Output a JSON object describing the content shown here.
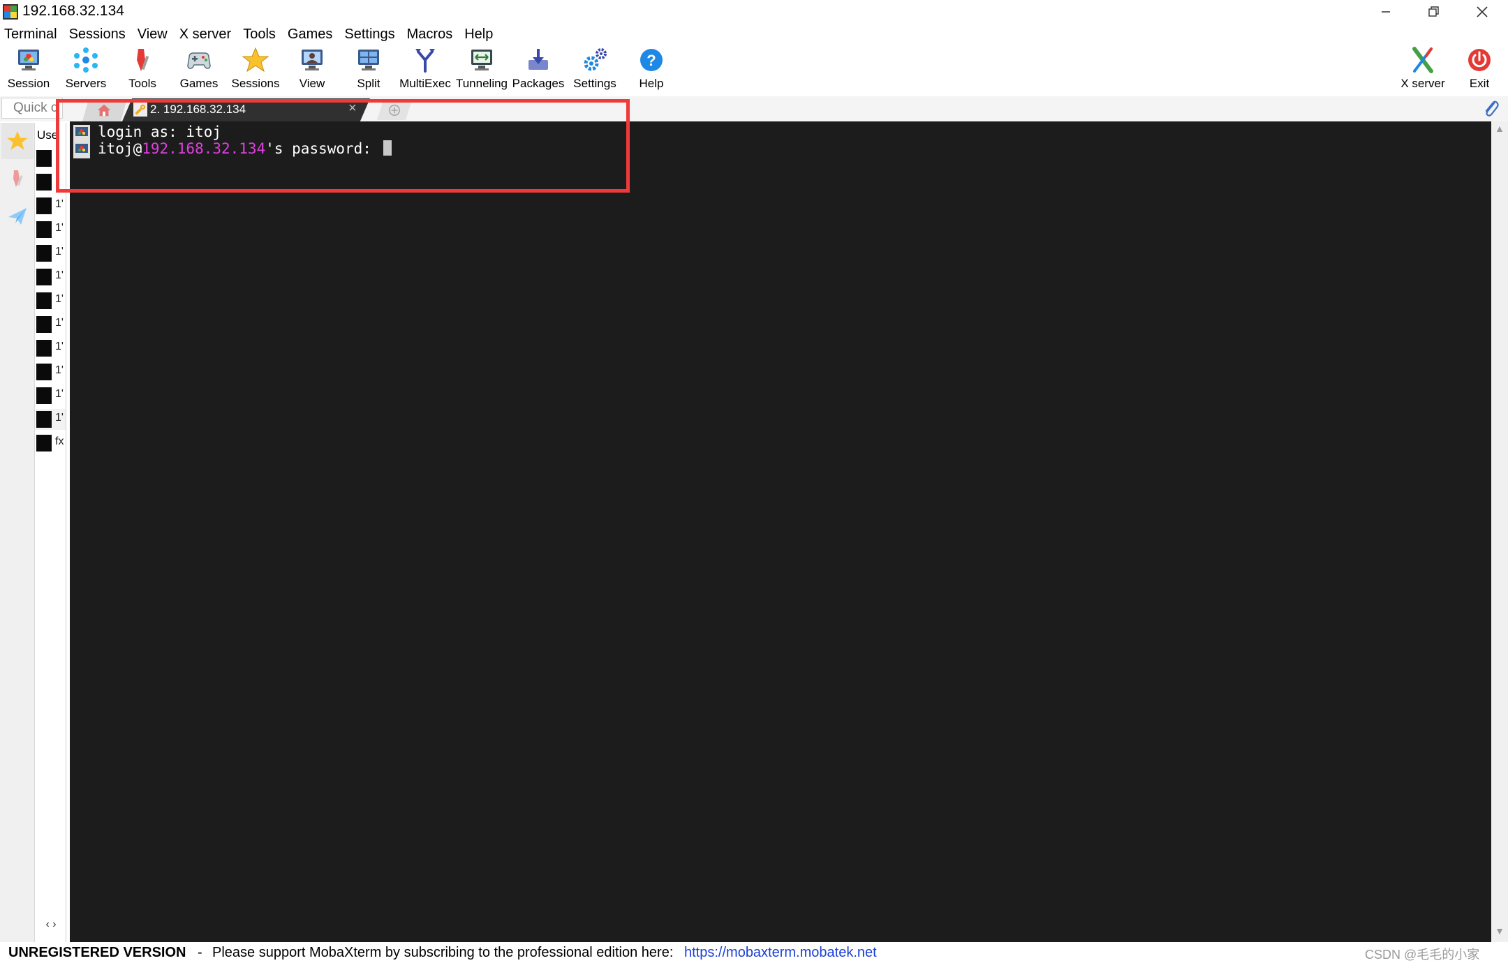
{
  "window": {
    "title": "192.168.32.134"
  },
  "menu": [
    "Terminal",
    "Sessions",
    "View",
    "X server",
    "Tools",
    "Games",
    "Settings",
    "Macros",
    "Help"
  ],
  "toolbar": {
    "session": "Session",
    "servers": "Servers",
    "tools": "Tools",
    "games": "Games",
    "sessions": "Sessions",
    "view": "View",
    "split": "Split",
    "multiexec": "MultiExec",
    "tunneling": "Tunneling",
    "packages": "Packages",
    "settings": "Settings",
    "help": "Help",
    "xserver": "X server",
    "exit": "Exit"
  },
  "tabs": {
    "quick_connect": "Quick c",
    "session_tab": "2. 192.168.32.134",
    "close": "×"
  },
  "sessions_panel": {
    "header": "Use",
    "rows": [
      "·",
      "·",
      "1'",
      "1'",
      "1'",
      "1'",
      "1'",
      "1'",
      "1'",
      "1'",
      "1'",
      "1'",
      "fx"
    ],
    "scroll": "‹  ›"
  },
  "terminal": {
    "line1": "login as: itoj",
    "line2_user": "itoj@",
    "line2_host": "192.168.32.134",
    "line2_rest": "'s password: "
  },
  "status": {
    "unregistered": "UNREGISTERED VERSION",
    "separator": "-",
    "message": "Please support MobaXterm by subscribing to the professional edition here:",
    "link": "https://mobaxterm.mobatek.net",
    "watermark": "CSDN @毛毛的小家"
  },
  "colors": {
    "terminal_bg": "#1c1c1c",
    "host_magenta": "#e040e0",
    "highlight_red": "#ef3a3a",
    "link_blue": "#1a3fd6"
  }
}
